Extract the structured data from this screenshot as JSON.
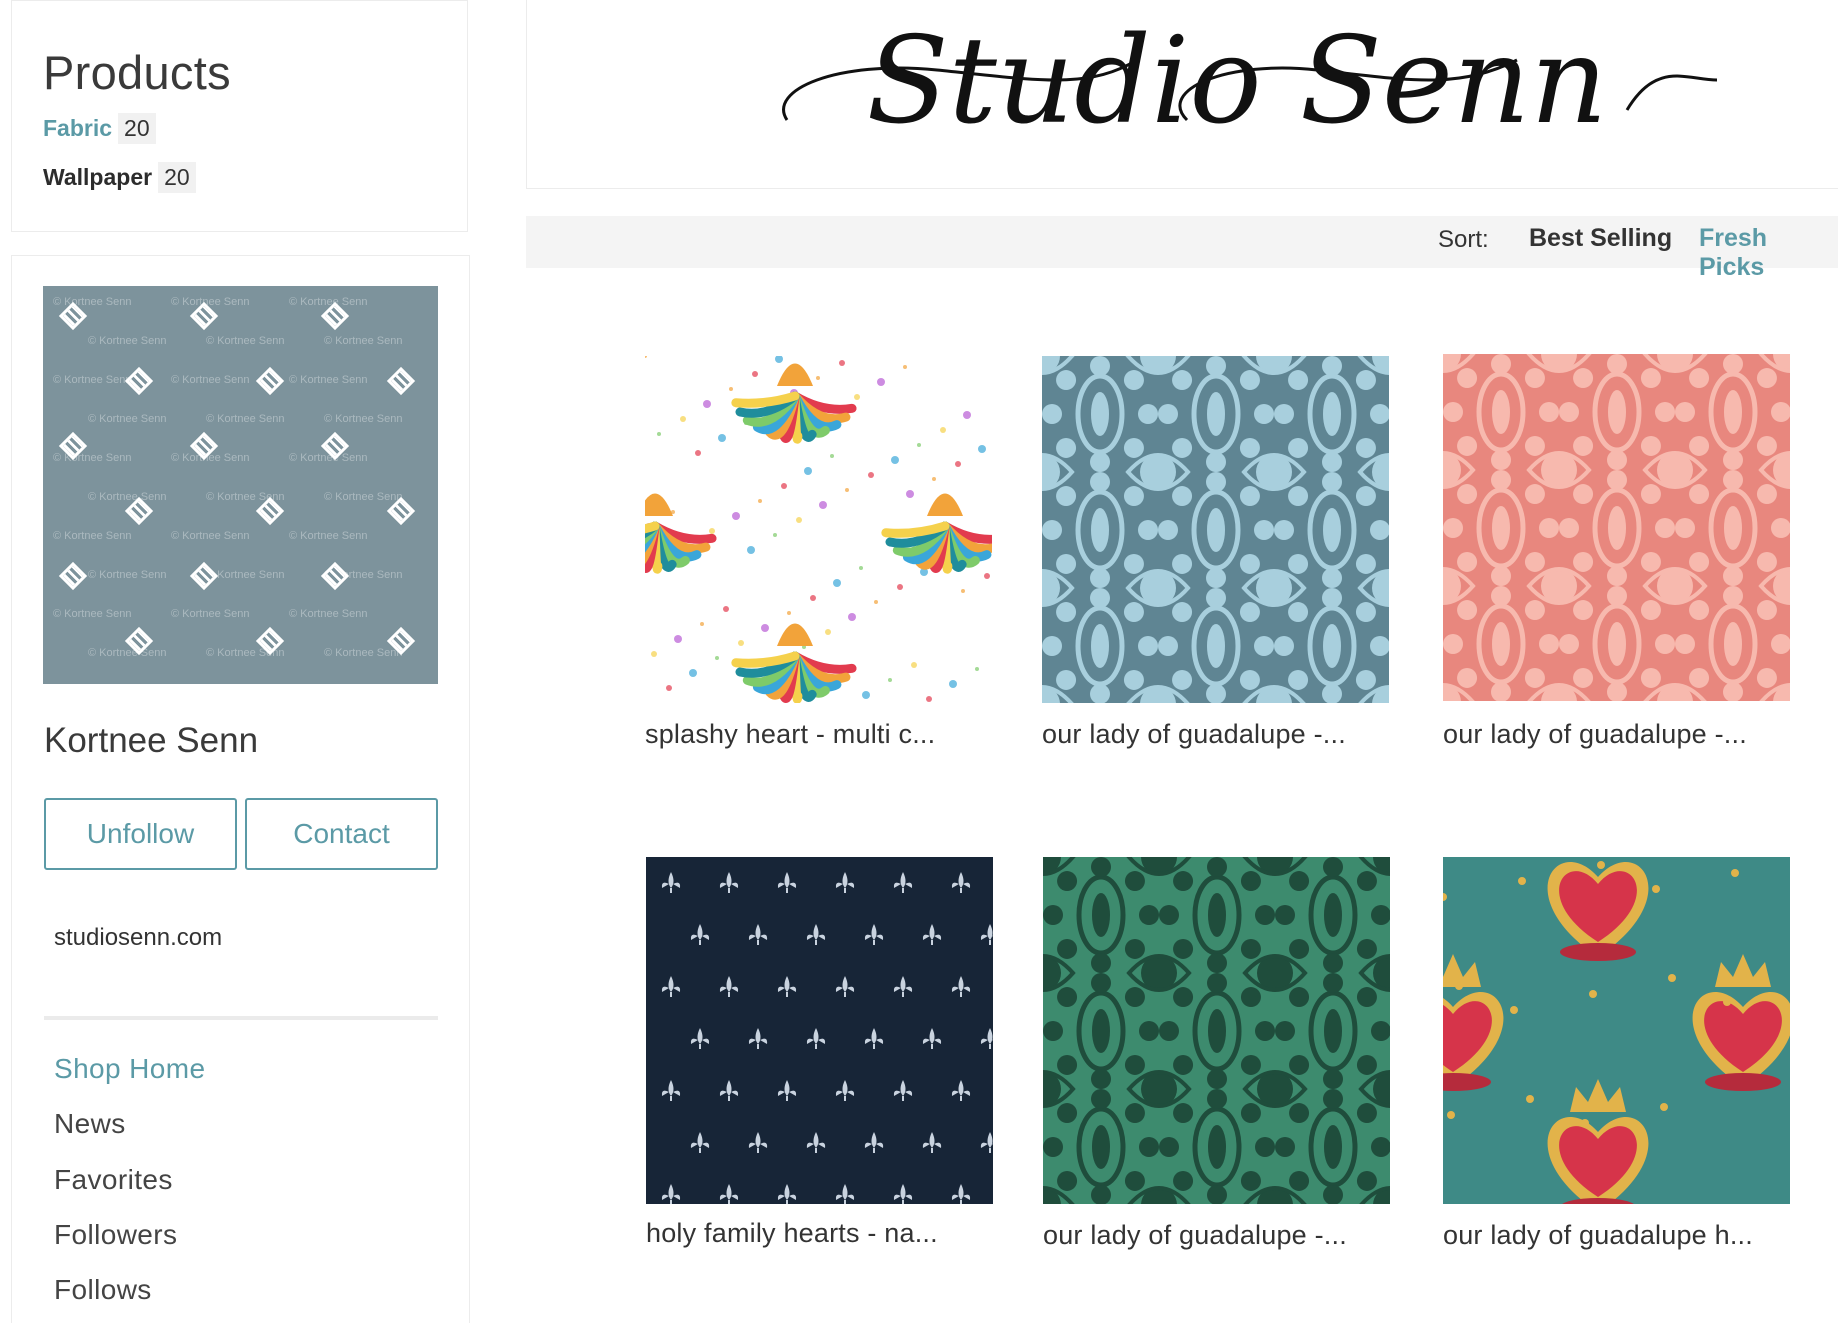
{
  "sidebar": {
    "products_title": "Products",
    "categories": [
      {
        "label": "Fabric",
        "count": "20"
      },
      {
        "label": "Wallpaper",
        "count": "20"
      }
    ],
    "profile_watermark": "© Kortnee Senn",
    "profile_name": "Kortnee Senn",
    "unfollow_label": "Unfollow",
    "contact_label": "Contact",
    "website": "studiosenn.com",
    "nav": [
      {
        "label": "Shop Home",
        "active": true
      },
      {
        "label": "News"
      },
      {
        "label": "Favorites"
      },
      {
        "label": "Followers"
      },
      {
        "label": "Follows"
      }
    ]
  },
  "header": {
    "logo_text": "Studio Senn"
  },
  "sort": {
    "label": "Sort:",
    "options": [
      {
        "label": "Best Selling"
      },
      {
        "label": "Fresh Picks",
        "active": true
      }
    ]
  },
  "products": [
    {
      "title": "splashy heart - multi c...",
      "pattern": "splashy-hearts-on-white"
    },
    {
      "title": "our lady of guadalupe -...",
      "pattern": "damask-light-blue"
    },
    {
      "title": "our lady of guadalupe -...",
      "pattern": "damask-coral"
    },
    {
      "title": "holy family hearts - na...",
      "pattern": "fleur-de-lis-navy"
    },
    {
      "title": "our lady of guadalupe -...",
      "pattern": "damask-green"
    },
    {
      "title": "our lady of guadalupe h...",
      "pattern": "crowned-hearts-teal"
    }
  ],
  "colors": {
    "accent": "#5b9aa6",
    "profile_bg": "#7d939c",
    "damask_blue_bg": "#5f8593",
    "damask_blue_fg": "#a8cfdd",
    "damask_coral_bg": "#e8877e",
    "damask_coral_fg": "#f7b9ae",
    "navy_bg": "#172537",
    "green_bg": "#3d8b6e",
    "green_fg": "#1f4d3c",
    "teal_bg": "#3e8a86",
    "heart_red": "#d6344a",
    "heart_gold": "#e2b34a"
  }
}
